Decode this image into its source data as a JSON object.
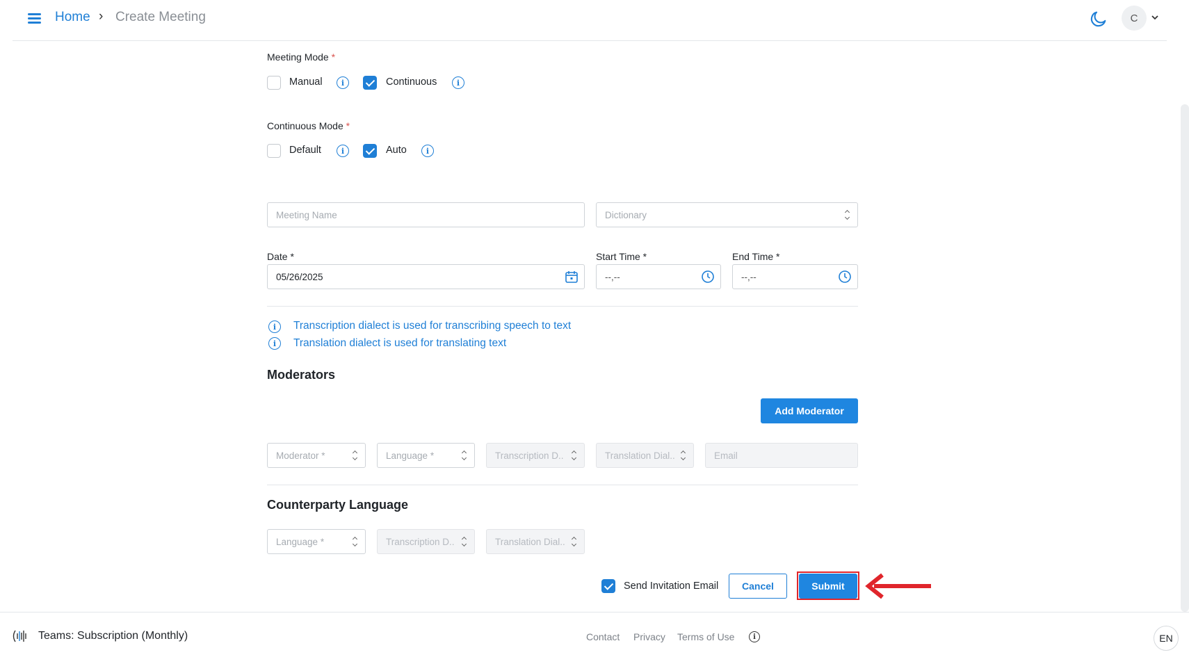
{
  "header": {
    "breadcrumb_home": "Home",
    "breadcrumb_separator": "›",
    "breadcrumb_current": "Create Meeting",
    "theme_icon": "moon-icon",
    "avatar_initial": "C",
    "avatar_chevron": "⌄"
  },
  "meeting_mode": {
    "label": "Meeting Mode",
    "required": "*",
    "options": [
      {
        "label": "Manual",
        "checked": false
      },
      {
        "label": "Continuous",
        "checked": true
      }
    ]
  },
  "continuous_mode": {
    "label": "Continuous Mode",
    "required": "*",
    "options": [
      {
        "label": "Default",
        "checked": false
      },
      {
        "label": "Auto",
        "checked": true
      }
    ]
  },
  "form": {
    "meeting_name_placeholder": "Meeting Name",
    "dictionary_placeholder": "Dictionary",
    "date_label": "Date *",
    "date_value": "05/26/2025",
    "start_time_label": "Start Time *",
    "start_time_value": "--,--",
    "end_time_label": "End Time *",
    "end_time_value": "--,--"
  },
  "notes": [
    "Transcription dialect is used for transcribing speech to text",
    "Translation dialect is used for translating text"
  ],
  "moderators": {
    "title": "Moderators",
    "add_button": "Add Moderator",
    "fields": {
      "moderator": "Moderator *",
      "language": "Language *",
      "transcription": "Transcription D..",
      "translation": "Translation Dial..",
      "email": "Email"
    }
  },
  "counterparty": {
    "title": "Counterparty Language",
    "fields": {
      "language": "Language *",
      "transcription": "Transcription D..",
      "translation": "Translation Dial.."
    }
  },
  "actions": {
    "send_invitation_label": "Send Invitation Email",
    "send_invitation_checked": true,
    "cancel": "Cancel",
    "submit": "Submit",
    "annotation_color": "#e0252b"
  },
  "footer": {
    "plan": "Teams: Subscription (Monthly)",
    "links": [
      "Contact",
      "Privacy",
      "Terms of Use"
    ],
    "language": "EN"
  },
  "colors": {
    "accent": "#1f7fd6",
    "primary_button": "#1f86e0"
  }
}
